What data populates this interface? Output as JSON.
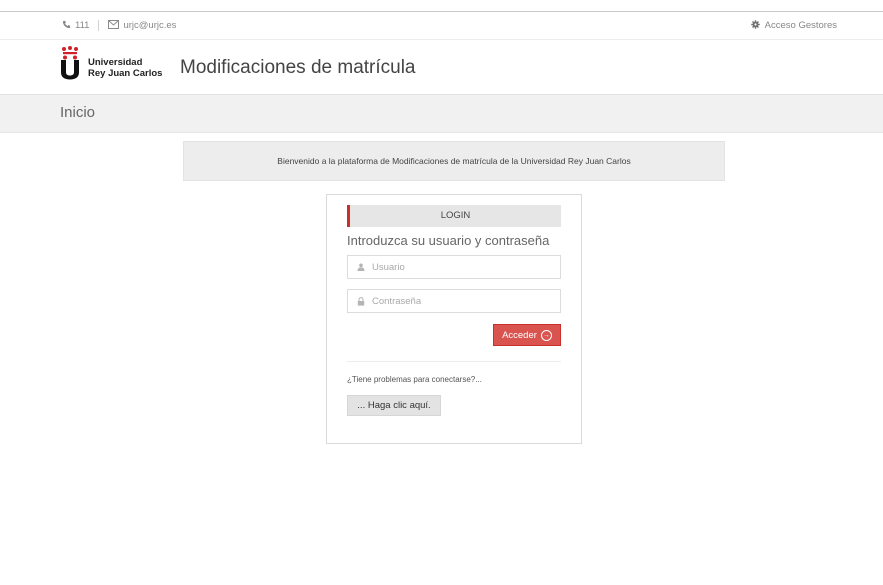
{
  "topbar": {
    "phone": "111",
    "email": "urjc@urjc.es",
    "manager_access": "Acceso Gestores",
    "icons": {
      "phone": "phone-icon",
      "email": "envelope-icon",
      "gear": "gear-icon"
    }
  },
  "header": {
    "logo_line1": "Universidad",
    "logo_line2": "Rey Juan Carlos",
    "title": "Modificaciones de matrícula"
  },
  "breadcrumb": {
    "current": "Inicio"
  },
  "welcome": {
    "message": "Bienvenido a la plataforma de Modificaciones de matrícula de la Universidad Rey Juan Carlos"
  },
  "login": {
    "tab": "LOGIN",
    "subtitle": "Introduzca su usuario y contraseña",
    "username_placeholder": "Usuario",
    "username_value": "",
    "password_placeholder": "Contraseña",
    "password_value": "",
    "submit_label": "Acceder",
    "problem_text": "¿Tiene problemas para conectarse?...",
    "help_button_label": "... Haga clic aquí."
  },
  "colors": {
    "accent_red": "#d9534f",
    "tab_border": "#c9302c",
    "breadcrumb_bg": "#f1f1f1",
    "welcome_bg": "#ededed"
  }
}
